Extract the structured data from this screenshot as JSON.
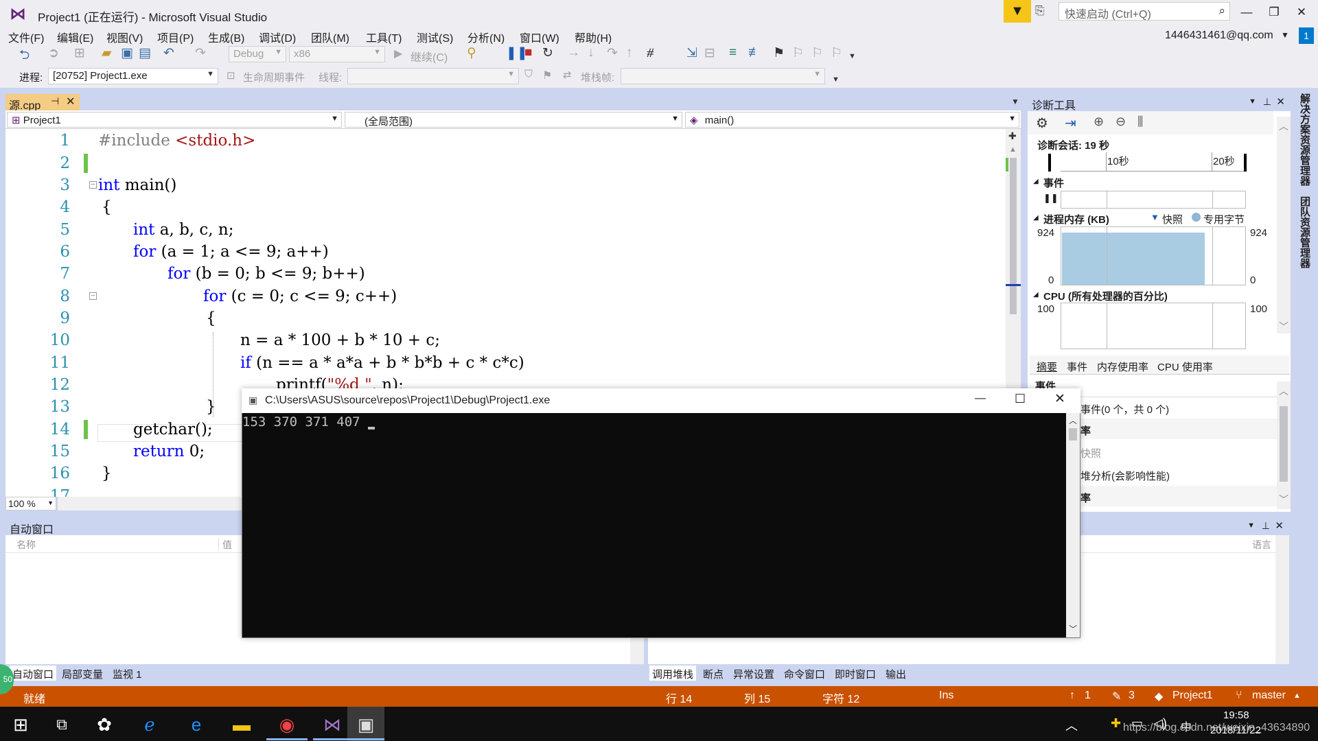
{
  "window": {
    "title": "Project1 (正在运行) - Microsoft Visual Studio",
    "quick_launch_placeholder": "快速启动 (Ctrl+Q)",
    "account": "1446431461@qq.com",
    "notification_count": "1"
  },
  "menu": [
    "文件(F)",
    "编辑(E)",
    "视图(V)",
    "项目(P)",
    "生成(B)",
    "调试(D)",
    "团队(M)",
    "工具(T)",
    "测试(S)",
    "分析(N)",
    "窗口(W)",
    "帮助(H)"
  ],
  "toolbar": {
    "config": "Debug",
    "platform": "x86",
    "continue_label": "继续(C)",
    "process_label": "进程:",
    "process_value": "[20752] Project1.exe",
    "lifecycle_label": "生命周期事件",
    "thread_label": "线程:",
    "stackframe_label": "堆栈帧:"
  },
  "editor": {
    "tab_name": "源.cpp",
    "project_dropdown": "Project1",
    "scope_dropdown": "(全局范围)",
    "member_dropdown": "main()",
    "zoom": "100 %",
    "line_numbers": [
      "1",
      "2",
      "3",
      "4",
      "5",
      "6",
      "7",
      "8",
      "9",
      "10",
      "11",
      "12",
      "13",
      "14",
      "15",
      "16",
      "17"
    ],
    "lines": {
      "l1_a": "#include ",
      "l1_b": "<stdio.h>",
      "l3_kw": "int",
      "l3_rest": " main()",
      "l4": "{",
      "l5_kw": "int",
      "l5_rest": " a, b, c, n;",
      "l6_kw": "for",
      "l6_rest": " (a = 1; a <= 9; a++)",
      "l7_kw": "for",
      "l7_rest": " (b = 0; b <= 9; b++)",
      "l8_kw": "for",
      "l8_rest": " (c = 0; c <= 9; c++)",
      "l9": "{",
      "l10": "n = a * 100 + b * 10 + c;",
      "l11_kw": "if",
      "l11_rest": " (n == a * a*a + b * b*b + c * c*c)",
      "l12_a": "printf(",
      "l12_str": "\"%d \"",
      "l12_b": ", n);",
      "l13": "}",
      "l14": "getchar();",
      "l15_kw": "return",
      "l15_rest": " 0;",
      "l16": "}"
    }
  },
  "diagnostics": {
    "title": "诊断工具",
    "session": "诊断会话: 19 秒",
    "tick_10": "10秒",
    "tick_20": "20秒",
    "events_label": "事件",
    "memory_label": "进程内存 (KB)",
    "snapshot_label": "快照",
    "private_bytes_label": "专用字节",
    "mem_max": "924",
    "mem_min": "0",
    "cpu_label": "CPU (所有处理器的百分比)",
    "cpu_max": "100",
    "tabs": [
      "摘要",
      "事件",
      "内存使用率",
      "CPU 使用率"
    ],
    "section_events": "事件",
    "events_count": "事件(0 个，共 0 个)",
    "section_memory": "率",
    "snapshot_item": "快照",
    "heap_item": "堆分析(会影响性能)",
    "section_cpu": "率"
  },
  "side_tabs": [
    "解决方案资源管理器",
    "团队资源管理器"
  ],
  "auto_panel": {
    "title": "自动窗口",
    "col_name": "名称",
    "col_value": "值",
    "col_lang": "语言",
    "tabs_left": [
      "自动窗口",
      "局部变量",
      "监视 1"
    ],
    "tabs_right": [
      "调用堆栈",
      "断点",
      "异常设置",
      "命令窗口",
      "即时窗口",
      "输出"
    ]
  },
  "console": {
    "title": "C:\\Users\\ASUS\\source\\repos\\Project1\\Debug\\Project1.exe",
    "output": "153 370 371 407"
  },
  "statusbar": {
    "ready": "就绪",
    "line": "行 14",
    "col": "列 15",
    "char": "字符 12",
    "mode": "Ins",
    "push": "1",
    "pencil": "3",
    "project": "Project1",
    "branch": "master"
  },
  "taskbar": {
    "time": "19:58",
    "date": "2018/11/22",
    "watermark": "https://blog.csdn.net/weixin_43634890",
    "ime": "中",
    "badge": "50"
  }
}
